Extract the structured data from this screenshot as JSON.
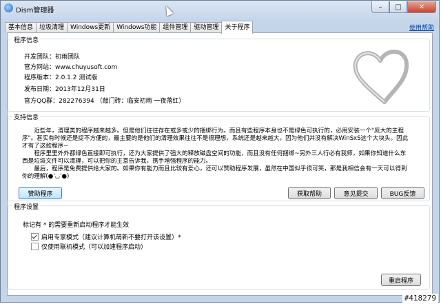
{
  "window": {
    "title": "Dism管理器"
  },
  "tabs": [
    {
      "label": "基本信息"
    },
    {
      "label": "垃圾清理"
    },
    {
      "label": "Windows更新"
    },
    {
      "label": "Windows功能"
    },
    {
      "label": "组件管理"
    },
    {
      "label": "驱动管理"
    },
    {
      "label": "关于程序"
    }
  ],
  "help_link": "使用帮助",
  "program_info": {
    "title": "程序信息",
    "lines": [
      "开发团队：初雨团队",
      "官方网站：www.chuyusoft.com",
      "程序版本：2.0.1.2  测试版",
      "发布日期：2013年12月31日",
      "官方QQ群：282276394 （敲门砖：临安初雨 一夜落红）"
    ]
  },
  "support_info": {
    "title": "支持信息",
    "paragraph": [
      "　　近些年，清理类的程序越来越多。但是他们往往存在或多或少的捆绑行为。而且有些程序本身也不是绿色可执行的，必用安装一个\"庞大的主程",
      "序\"。甚实有时候还是捉不方便的，最主要的是他们的清理效果往往不是很理想，系统还是越来越大，因为他们并没有解决WinSxS这个大块头。因此",
      "才有了这款程序~",
      "　　程序里里外外都绿色直接即可执行，还为大家提供了强大的释放磁盘空间的功能，而且没有任何捆绑~另外三人行必有我师，如果你知道什么东",
      "西是垃圾文件可以清理，可以把你的主意告诉我，携手增强程序的能力。",
      "　　最后，程序是免费提供给大家的。如果你有能力而且比较有爱心，还可以赞助程序发展，虽然在中国似乎很可笑，那是我相信会有一天可以得到",
      "你的理解(●'◡'●)"
    ],
    "buttons": {
      "sponsor": "赞助程序",
      "get_help": "获取帮助",
      "feedback": "意见提交",
      "bug_report": "BUG反馈"
    }
  },
  "settings": {
    "title": "程序设置",
    "note": "标记有 * 的需要重新启动程序才能生效",
    "options": [
      {
        "label": "启用专家模式（建议计算机萌新不要打开该设置）*",
        "checked": true
      },
      {
        "label": "仅使用联机模式（可以加速程序启动）",
        "checked": false
      }
    ],
    "restart_button": "重启程序"
  },
  "watermark": "#418279"
}
